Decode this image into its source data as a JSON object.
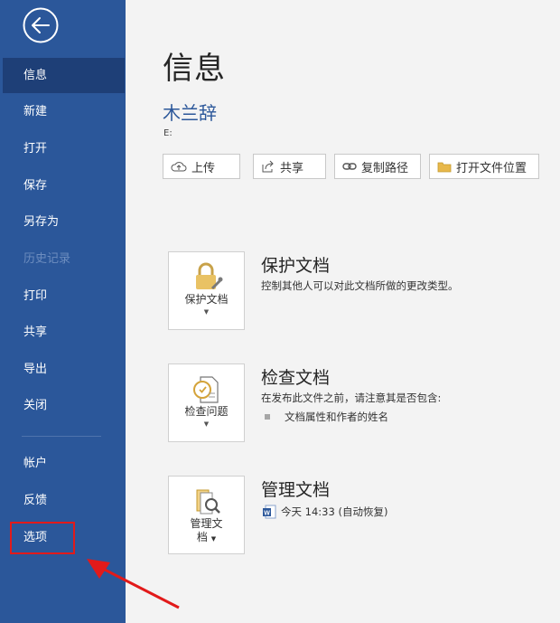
{
  "sidebar": {
    "items": [
      {
        "label": "信息"
      },
      {
        "label": "新建"
      },
      {
        "label": "打开"
      },
      {
        "label": "保存"
      },
      {
        "label": "另存为"
      },
      {
        "label": "历史记录"
      },
      {
        "label": "打印"
      },
      {
        "label": "共享"
      },
      {
        "label": "导出"
      },
      {
        "label": "关闭"
      },
      {
        "label": "帐户"
      },
      {
        "label": "反馈"
      },
      {
        "label": "选项"
      }
    ]
  },
  "main": {
    "title": "信息",
    "doc_name": "木兰辞",
    "doc_path": "E:",
    "buttons": {
      "upload": "上传",
      "share": "共享",
      "copy_path": "复制路径",
      "open_location": "打开文件位置"
    },
    "sections": {
      "protect": {
        "tile_label": "保护文档",
        "title": "保护文档",
        "desc": "控制其他人可以对此文档所做的更改类型。"
      },
      "inspect": {
        "tile_label": "检查问题",
        "title": "检查文档",
        "desc": "在发布此文件之前，请注意其是否包含:",
        "bullet": "文档属性和作者的姓名"
      },
      "manage": {
        "tile_label_1": "管理文",
        "tile_label_2": "档",
        "title": "管理文档",
        "version": "今天 14:33 (自动恢复)"
      }
    }
  },
  "colors": {
    "sidebar": "#2b579a",
    "sidebar_active": "#1e3f77",
    "accent_text": "#2b579a",
    "highlight": "#e21a1a"
  }
}
